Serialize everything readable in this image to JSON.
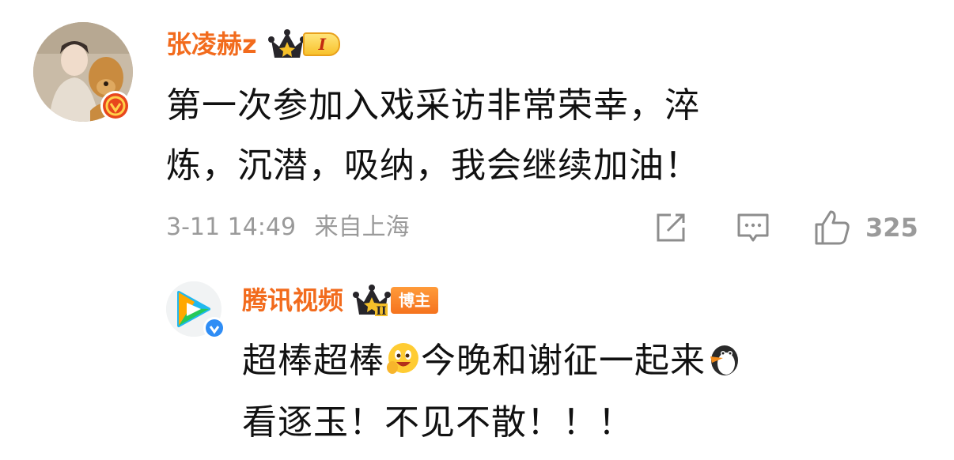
{
  "comment": {
    "username": "张凌赫z",
    "level_label": "I",
    "text_line1": "第一次参加入戏采访非常荣幸，淬",
    "text_line2": "炼，沉潜，吸纳，我会继续加油！",
    "time": "3-11 14:49",
    "location": "来自上海",
    "like_count": "325",
    "colors": {
      "name": "#f26b1d",
      "verified": "#e8461c",
      "meta": "#9a9a9a"
    }
  },
  "reply": {
    "username": "腾讯视频",
    "level_label": "II",
    "tag_label": "博主",
    "text_part1": "超棒超棒",
    "text_part2": "今晚和谢征一起来",
    "text_line2": "看逐玉！不见不散！！！",
    "emoji_1": "smiling-face-emoji",
    "emoji_2": "penguin-emoji",
    "colors": {
      "verified": "#2f8df5",
      "tag": "#f5731e"
    }
  }
}
